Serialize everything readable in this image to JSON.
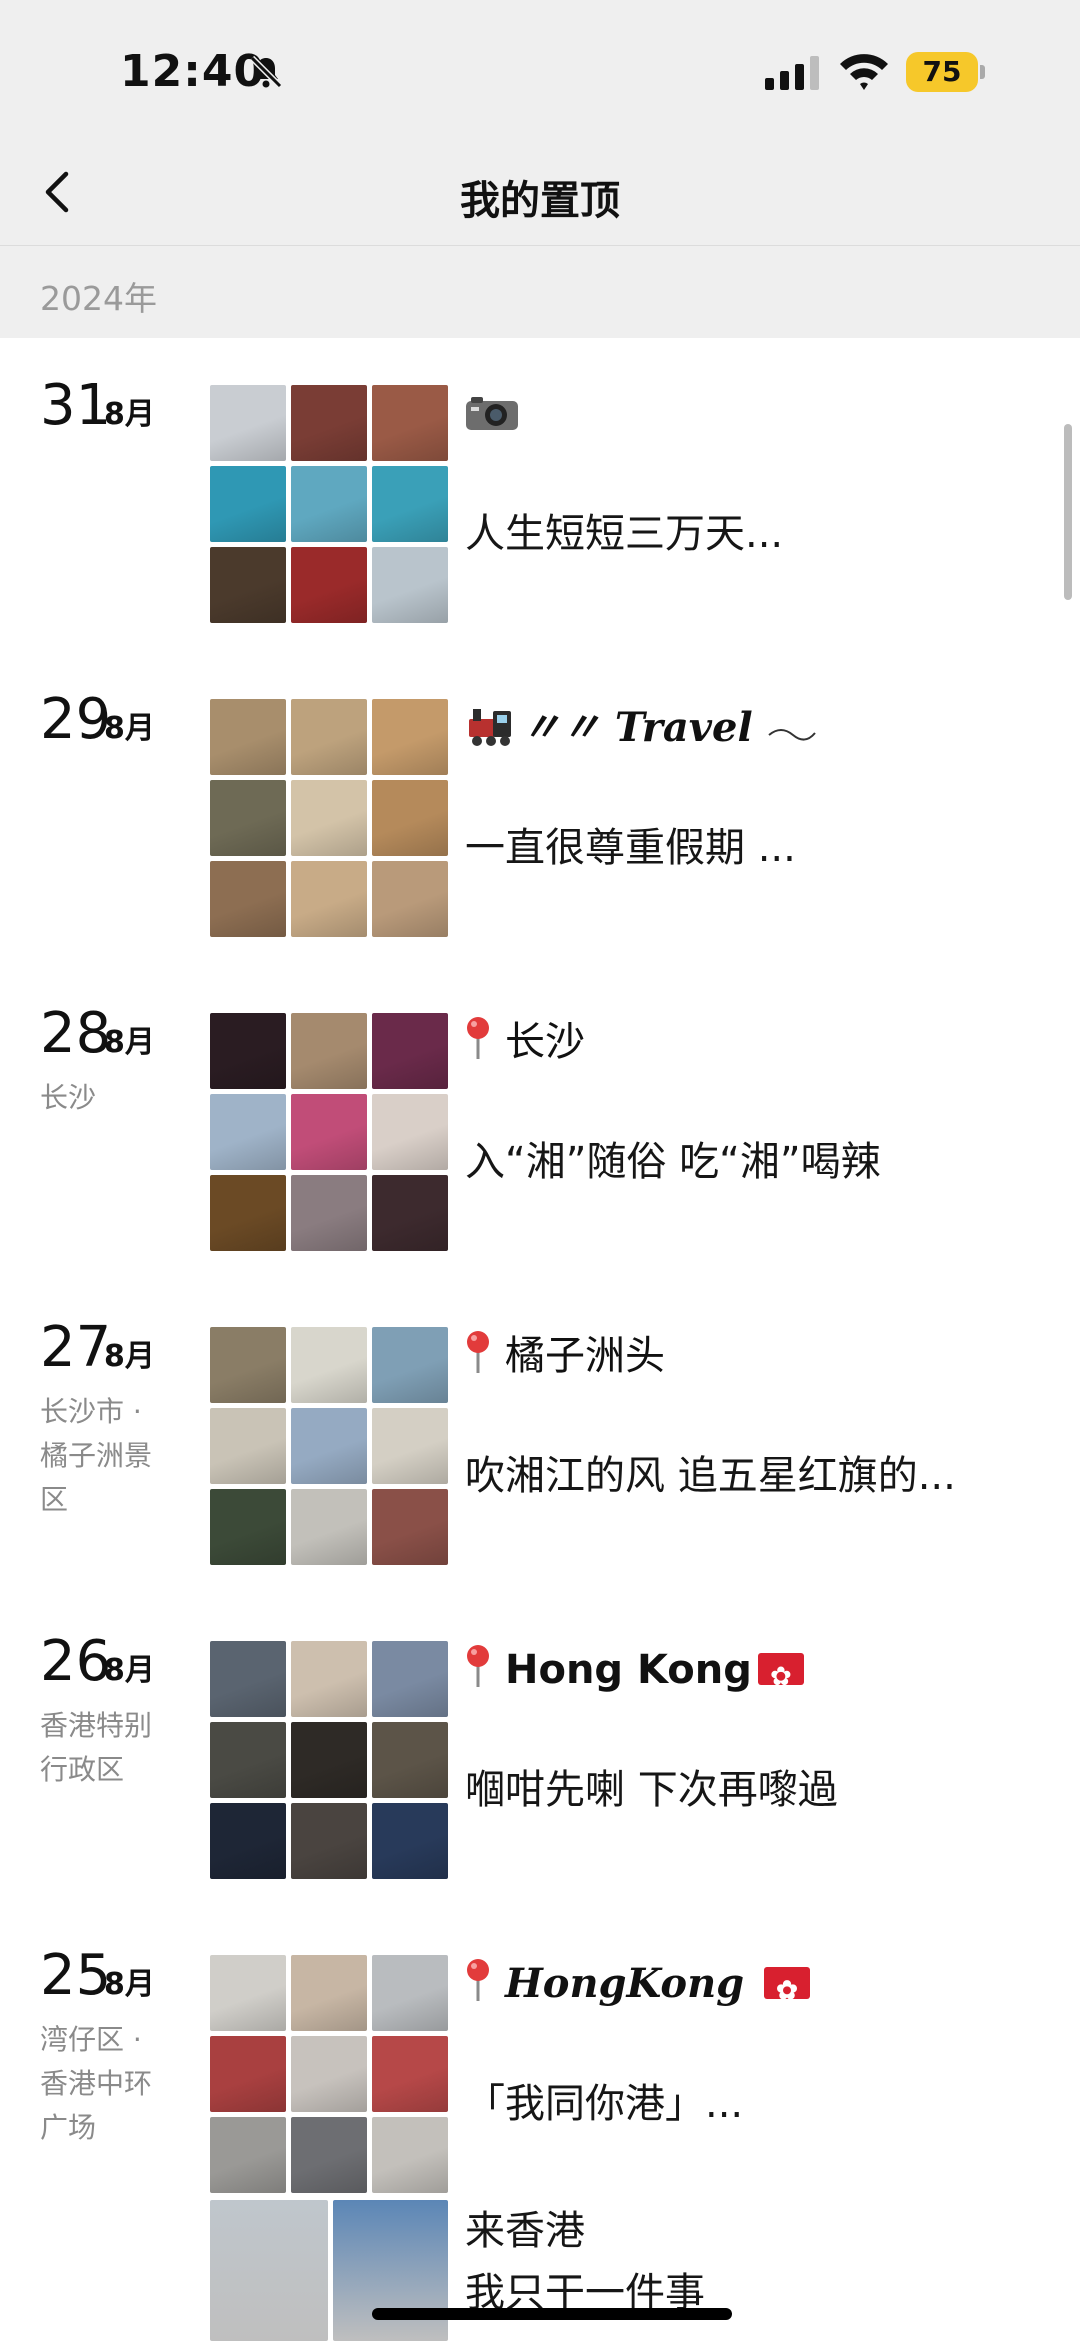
{
  "status_bar": {
    "time": "12:40",
    "battery": "75"
  },
  "nav": {
    "title": "我的置顶"
  },
  "year": "2024年",
  "entries": [
    {
      "day": "31",
      "month": "8月",
      "location": "",
      "title": "",
      "body": "人生短短三万天...",
      "palette": [
        "#c9cdd2",
        "#7a3d35",
        "#9a5a46",
        "#2f98b4",
        "#5fa8c0",
        "#3aa0b8",
        "#4b3a2c",
        "#9a2a2a",
        "#b9c4cc"
      ]
    },
    {
      "day": "29",
      "month": "8月",
      "location": "",
      "title": "〃〃 Travel",
      "body": "一直很尊重假期 ...",
      "palette": [
        "#a88e6c",
        "#bda27d",
        "#c49a6a",
        "#6e6a55",
        "#d3c3a8",
        "#b58a5b",
        "#8d6e52",
        "#c8ab87",
        "#b99a7a"
      ]
    },
    {
      "day": "28",
      "month": "8月",
      "location": "长沙",
      "title": "长沙",
      "body": "入“湘”随俗 吃“湘”喝辣",
      "palette": [
        "#2a1c22",
        "#a58a6e",
        "#6a2a4a",
        "#9fb3c8",
        "#c14d78",
        "#d9cfc8",
        "#6b4a25",
        "#8a7c80",
        "#3d2a2e"
      ]
    },
    {
      "day": "27",
      "month": "8月",
      "location": "长沙市 · 橘子洲景区",
      "title": "橘子洲头",
      "body": "吹湘江的风 追五星红旗的...",
      "palette": [
        "#8a7d66",
        "#d8d6cc",
        "#7f9fb5",
        "#c9c3b6",
        "#95aac2",
        "#d4cfc4",
        "#3c4a38",
        "#c2c0ba",
        "#8a5048"
      ]
    },
    {
      "day": "26",
      "month": "8月",
      "location": "香港特别行政区",
      "title": "Hong Kong",
      "body": "嗰咁先喇 下次再嚟過",
      "palette": [
        "#5a6470",
        "#cdbfae",
        "#7a8aa2",
        "#4a4a44",
        "#2e2a26",
        "#5c5448",
        "#1e2636",
        "#4a4440",
        "#283a5a"
      ]
    },
    {
      "day": "25",
      "month": "8月",
      "location": "湾仔区 · 香港中环广场",
      "title": "HongKong",
      "body": "「我同你港」...",
      "palette": [
        "#d0cec9",
        "#c7b6a4",
        "#b9bcbf",
        "#a94040",
        "#c7c2bd",
        "#b64848",
        "#9a9996",
        "#6d6e72",
        "#c3c0bb"
      ]
    }
  ],
  "extra": {
    "lines": [
      "来香港",
      "我只干一件事"
    ],
    "palette": [
      "#bfc6cc",
      "#5b86b6"
    ]
  }
}
